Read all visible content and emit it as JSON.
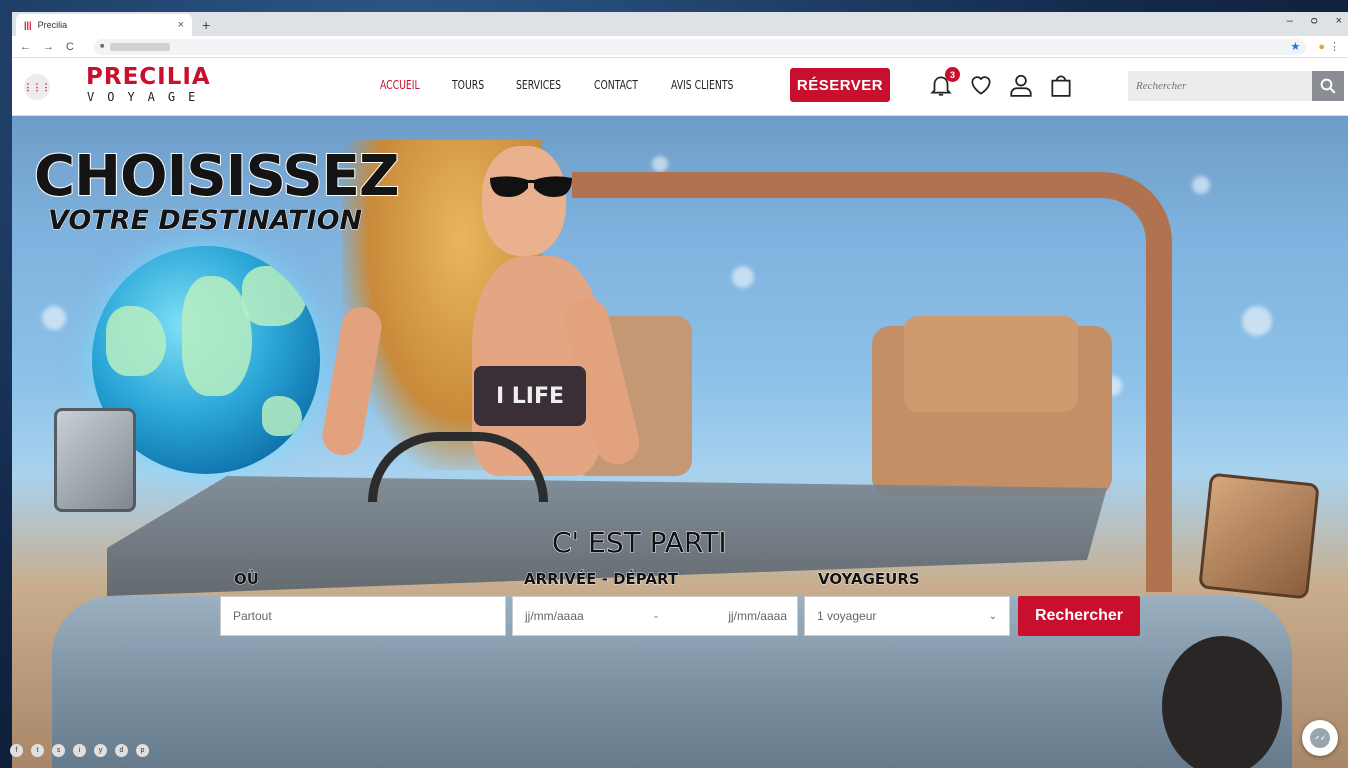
{
  "browser": {
    "tab_title": "Precilia",
    "tab_close": "×",
    "new_tab": "+",
    "window_controls": [
      "–",
      "ᴑ",
      "×"
    ],
    "nav_buttons": [
      "←",
      "→",
      "C"
    ],
    "lock": "🔒",
    "bookmark_star": "★",
    "menu_dots": "⋮"
  },
  "header": {
    "menu_icon": "⋮⋮⋮",
    "logo_line1": "PRECILIA",
    "logo_line2": "VOYAGE",
    "nav": {
      "home": "ACCUEIL",
      "tours": "TOURS",
      "services": "SERVICES",
      "contact": "CONTACT",
      "reviews": "AVIS CLIENTS"
    },
    "reserve_button": "RÉSERVER",
    "notification_count": "3",
    "search_placeholder": "Rechercher"
  },
  "hero": {
    "headline_big": "CHOISISSEZ",
    "headline_small": "VOTRE DESTINATION",
    "swimsuit_text": "I LIFE"
  },
  "form": {
    "title": "C' EST PARTI",
    "where_label": "OÙ",
    "where_value": "Partout",
    "dates_label": "ARRIVÉE - DÉPART",
    "arrival_placeholder": "jj/mm/aaaa",
    "date_separator": "-",
    "departure_placeholder": "jj/mm/aaaa",
    "travelers_label": "VOYAGEURS",
    "travelers_value": "1 voyageur",
    "submit": "Rechercher"
  },
  "social": [
    "f",
    "t",
    "s",
    "i",
    "y",
    "d",
    "p"
  ],
  "colors": {
    "accent": "#c8102e",
    "search_button": "#8a8d92"
  }
}
